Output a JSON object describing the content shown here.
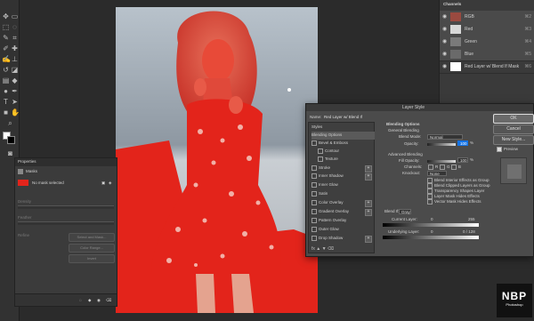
{
  "channels": {
    "title": "Channels",
    "rows": [
      {
        "label": "RGB",
        "key": "⌘2",
        "thumb": "#9a4a40",
        "selected": true
      },
      {
        "label": "Red",
        "key": "⌘3",
        "thumb": "#d8d8d8",
        "selected": true
      },
      {
        "label": "Green",
        "key": "⌘4",
        "thumb": "#7a7a7a",
        "selected": true
      },
      {
        "label": "Blue",
        "key": "⌘5",
        "thumb": "#6a6a6a",
        "selected": true
      },
      {
        "label": "Red Layer w/ Blend If Mask",
        "key": "⌘6",
        "thumb": "#ffffff",
        "selected": false
      }
    ]
  },
  "properties": {
    "title": "Properties",
    "tab": "Masks",
    "mask_status": "No mask selected",
    "rows": [
      "Density",
      "Feather",
      "Refine"
    ],
    "buttons": [
      "Select and Mask...",
      "Color Range...",
      "Invert"
    ]
  },
  "layer_style": {
    "title": "Layer Style",
    "name_label": "Name:",
    "name_value": "Red Layer w/ Blend If",
    "styles_header": "Styles",
    "blending_options_item": "Blending Options",
    "style_items": [
      {
        "label": "Bevel & Emboss",
        "plus": false
      },
      {
        "label": "Contour",
        "plus": false,
        "indent": true
      },
      {
        "label": "Texture",
        "plus": false,
        "indent": true
      },
      {
        "label": "Stroke",
        "plus": true
      },
      {
        "label": "Inner Shadow",
        "plus": true
      },
      {
        "label": "Inner Glow",
        "plus": false
      },
      {
        "label": "Satin",
        "plus": false
      },
      {
        "label": "Color Overlay",
        "plus": true
      },
      {
        "label": "Gradient Overlay",
        "plus": true
      },
      {
        "label": "Pattern Overlay",
        "plus": false
      },
      {
        "label": "Outer Glow",
        "plus": false
      },
      {
        "label": "Drop Shadow",
        "plus": true
      }
    ],
    "blending": {
      "header": "Blending Options",
      "general": "General Blending",
      "blend_mode_label": "Blend Mode:",
      "blend_mode": "Normal",
      "opacity_label": "Opacity:",
      "opacity": "100",
      "advanced": "Advanced Blending",
      "fill_label": "Fill Opacity:",
      "fill": "100",
      "channels_label": "Channels:",
      "channels": [
        "R",
        "G",
        "B"
      ],
      "knockout_label": "Knockout:",
      "knockout": "None",
      "checks": [
        "Blend Interior Effects as Group",
        "Blend Clipped Layers as Group",
        "Transparency Shapes Layer",
        "Layer Mask Hides Effects",
        "Vector Mask Hides Effects"
      ],
      "blend_if_label": "Blend If:",
      "blend_if": "Gray",
      "current_layer_label": "Current Layer:",
      "current_layer_values": [
        "0",
        "255"
      ],
      "underlying_label": "Underlying Layer:",
      "underlying_values": [
        "0",
        "0 / 128"
      ]
    },
    "buttons": {
      "ok": "OK",
      "cancel": "Cancel",
      "new_style": "New Style...",
      "preview": "Preview"
    }
  },
  "logo": {
    "text": "NBP",
    "sub": "Photoshop"
  },
  "colors": {
    "accent_red": "#e3241b",
    "selection_blue": "#1473e6"
  }
}
